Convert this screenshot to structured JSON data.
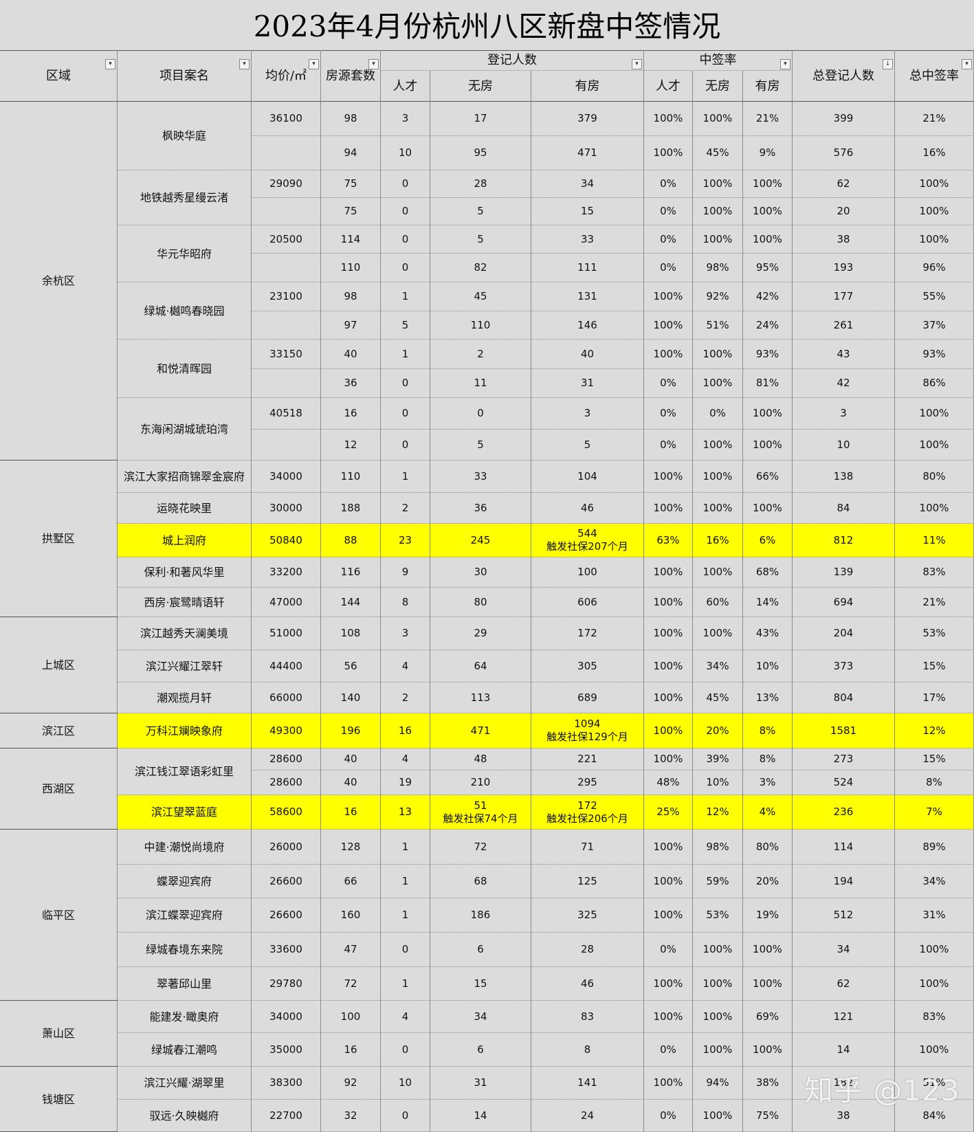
{
  "title": "2023年4月份杭州八区新盘中签情况",
  "headers": {
    "region": "区域",
    "project": "项目案名",
    "price": "均价/㎡",
    "units": "房源套数",
    "registered_group": "登记人数",
    "rate_group": "中签率",
    "talent": "人才",
    "no_house": "无房",
    "has_house": "有房",
    "total_registered": "总登记人数",
    "total_rate": "总中签率"
  },
  "rows": [
    {
      "region": "余杭区",
      "project": "枫映华庭",
      "price": "36100",
      "units": "98",
      "reg_talent": "3",
      "reg_nohouse": "17",
      "reg_hashouse": "379",
      "rate_talent": "100%",
      "rate_nohouse": "100%",
      "rate_hashouse": "21%",
      "total_reg": "399",
      "total_rate": "21%"
    },
    {
      "region": "",
      "project": "",
      "price": "",
      "units": "94",
      "reg_talent": "10",
      "reg_nohouse": "95",
      "reg_hashouse": "471",
      "rate_talent": "100%",
      "rate_nohouse": "45%",
      "rate_hashouse": "9%",
      "total_reg": "576",
      "total_rate": "16%"
    },
    {
      "region": "",
      "project": "地铁越秀星缦云渚",
      "price": "29090",
      "units": "75",
      "reg_talent": "0",
      "reg_nohouse": "28",
      "reg_hashouse": "34",
      "rate_talent": "0%",
      "rate_nohouse": "100%",
      "rate_hashouse": "100%",
      "total_reg": "62",
      "total_rate": "100%"
    },
    {
      "region": "",
      "project": "",
      "price": "",
      "units": "75",
      "reg_talent": "0",
      "reg_nohouse": "5",
      "reg_hashouse": "15",
      "rate_talent": "0%",
      "rate_nohouse": "100%",
      "rate_hashouse": "100%",
      "total_reg": "20",
      "total_rate": "100%"
    },
    {
      "region": "",
      "project": "华元华昭府",
      "price": "20500",
      "units": "114",
      "reg_talent": "0",
      "reg_nohouse": "5",
      "reg_hashouse": "33",
      "rate_talent": "0%",
      "rate_nohouse": "100%",
      "rate_hashouse": "100%",
      "total_reg": "38",
      "total_rate": "100%"
    },
    {
      "region": "",
      "project": "",
      "price": "",
      "units": "110",
      "reg_talent": "0",
      "reg_nohouse": "82",
      "reg_hashouse": "111",
      "rate_talent": "0%",
      "rate_nohouse": "98%",
      "rate_hashouse": "95%",
      "total_reg": "193",
      "total_rate": "96%"
    },
    {
      "region": "",
      "project": "绿城·樾鸣春晓园",
      "price": "23100",
      "units": "98",
      "reg_talent": "1",
      "reg_nohouse": "45",
      "reg_hashouse": "131",
      "rate_talent": "100%",
      "rate_nohouse": "92%",
      "rate_hashouse": "42%",
      "total_reg": "177",
      "total_rate": "55%"
    },
    {
      "region": "",
      "project": "",
      "price": "",
      "units": "97",
      "reg_talent": "5",
      "reg_nohouse": "110",
      "reg_hashouse": "146",
      "rate_talent": "100%",
      "rate_nohouse": "51%",
      "rate_hashouse": "24%",
      "total_reg": "261",
      "total_rate": "37%"
    },
    {
      "region": "",
      "project": "和悦清晖园",
      "price": "33150",
      "units": "40",
      "reg_talent": "1",
      "reg_nohouse": "2",
      "reg_hashouse": "40",
      "rate_talent": "100%",
      "rate_nohouse": "100%",
      "rate_hashouse": "93%",
      "total_reg": "43",
      "total_rate": "93%"
    },
    {
      "region": "",
      "project": "",
      "price": "",
      "units": "36",
      "reg_talent": "0",
      "reg_nohouse": "11",
      "reg_hashouse": "31",
      "rate_talent": "0%",
      "rate_nohouse": "100%",
      "rate_hashouse": "81%",
      "total_reg": "42",
      "total_rate": "86%"
    },
    {
      "region": "",
      "project": "东海闲湖城琥珀湾",
      "price": "40518",
      "units": "16",
      "reg_talent": "0",
      "reg_nohouse": "0",
      "reg_hashouse": "3",
      "rate_talent": "0%",
      "rate_nohouse": "0%",
      "rate_hashouse": "100%",
      "total_reg": "3",
      "total_rate": "100%"
    },
    {
      "region": "",
      "project": "",
      "price": "",
      "units": "12",
      "reg_talent": "0",
      "reg_nohouse": "5",
      "reg_hashouse": "5",
      "rate_talent": "0%",
      "rate_nohouse": "100%",
      "rate_hashouse": "100%",
      "total_reg": "10",
      "total_rate": "100%"
    },
    {
      "region": "拱墅区",
      "project": "滨江大家招商锦翠金宸府",
      "price": "34000",
      "units": "110",
      "reg_talent": "1",
      "reg_nohouse": "33",
      "reg_hashouse": "104",
      "rate_talent": "100%",
      "rate_nohouse": "100%",
      "rate_hashouse": "66%",
      "total_reg": "138",
      "total_rate": "80%"
    },
    {
      "region": "",
      "project": "运晓花映里",
      "price": "30000",
      "units": "188",
      "reg_talent": "2",
      "reg_nohouse": "36",
      "reg_hashouse": "46",
      "rate_talent": "100%",
      "rate_nohouse": "100%",
      "rate_hashouse": "100%",
      "total_reg": "84",
      "total_rate": "100%"
    },
    {
      "region": "",
      "project": "城上润府",
      "price": "50840",
      "units": "88",
      "reg_talent": "23",
      "reg_nohouse": "245",
      "reg_hashouse": "544\n触发社保207个月",
      "rate_talent": "63%",
      "rate_nohouse": "16%",
      "rate_hashouse": "6%",
      "total_reg": "812",
      "total_rate": "11%",
      "highlight": true
    },
    {
      "region": "",
      "project": "保利·和著风华里",
      "price": "33200",
      "units": "116",
      "reg_talent": "9",
      "reg_nohouse": "30",
      "reg_hashouse": "100",
      "rate_talent": "100%",
      "rate_nohouse": "100%",
      "rate_hashouse": "68%",
      "total_reg": "139",
      "total_rate": "83%"
    },
    {
      "region": "",
      "project": "西房·宸鹭晴语轩",
      "price": "47000",
      "units": "144",
      "reg_talent": "8",
      "reg_nohouse": "80",
      "reg_hashouse": "606",
      "rate_talent": "100%",
      "rate_nohouse": "60%",
      "rate_hashouse": "14%",
      "total_reg": "694",
      "total_rate": "21%"
    },
    {
      "region": "上城区",
      "project": "滨江越秀天澜美境",
      "price": "51000",
      "units": "108",
      "reg_talent": "3",
      "reg_nohouse": "29",
      "reg_hashouse": "172",
      "rate_talent": "100%",
      "rate_nohouse": "100%",
      "rate_hashouse": "43%",
      "total_reg": "204",
      "total_rate": "53%"
    },
    {
      "region": "",
      "project": "滨江兴耀江翠轩",
      "price": "44400",
      "units": "56",
      "reg_talent": "4",
      "reg_nohouse": "64",
      "reg_hashouse": "305",
      "rate_talent": "100%",
      "rate_nohouse": "34%",
      "rate_hashouse": "10%",
      "total_reg": "373",
      "total_rate": "15%"
    },
    {
      "region": "",
      "project": "潮观揽月轩",
      "price": "66000",
      "units": "140",
      "reg_talent": "2",
      "reg_nohouse": "113",
      "reg_hashouse": "689",
      "rate_talent": "100%",
      "rate_nohouse": "45%",
      "rate_hashouse": "13%",
      "total_reg": "804",
      "total_rate": "17%"
    },
    {
      "region": "滨江区",
      "project": "万科江斓映象府",
      "price": "49300",
      "units": "196",
      "reg_talent": "16",
      "reg_nohouse": "471",
      "reg_hashouse": "1094\n触发社保129个月",
      "rate_talent": "100%",
      "rate_nohouse": "20%",
      "rate_hashouse": "8%",
      "total_reg": "1581",
      "total_rate": "12%",
      "highlight": true
    },
    {
      "region": "西湖区",
      "project": "滨江钱江翠语彩虹里",
      "price": "28600",
      "units": "40",
      "reg_talent": "4",
      "reg_nohouse": "48",
      "reg_hashouse": "221",
      "rate_talent": "100%",
      "rate_nohouse": "39%",
      "rate_hashouse": "8%",
      "total_reg": "273",
      "total_rate": "15%"
    },
    {
      "region": "",
      "project": "",
      "price": "28600",
      "units": "40",
      "reg_talent": "19",
      "reg_nohouse": "210",
      "reg_hashouse": "295",
      "rate_talent": "48%",
      "rate_nohouse": "10%",
      "rate_hashouse": "3%",
      "total_reg": "524",
      "total_rate": "8%"
    },
    {
      "region": "",
      "project": "滨江望翠蓝庭",
      "price": "58600",
      "units": "16",
      "reg_talent": "13",
      "reg_nohouse": "51\n触发社保74个月",
      "reg_hashouse": "172\n触发社保206个月",
      "rate_talent": "25%",
      "rate_nohouse": "12%",
      "rate_hashouse": "4%",
      "total_reg": "236",
      "total_rate": "7%",
      "highlight": true
    },
    {
      "region": "临平区",
      "project": "中建·潮悦尚境府",
      "price": "26000",
      "units": "128",
      "reg_talent": "1",
      "reg_nohouse": "72",
      "reg_hashouse": "71",
      "rate_talent": "100%",
      "rate_nohouse": "98%",
      "rate_hashouse": "80%",
      "total_reg": "114",
      "total_rate": "89%"
    },
    {
      "region": "",
      "project": "蝶翠迎宾府",
      "price": "26600",
      "units": "66",
      "reg_talent": "1",
      "reg_nohouse": "68",
      "reg_hashouse": "125",
      "rate_talent": "100%",
      "rate_nohouse": "59%",
      "rate_hashouse": "20%",
      "total_reg": "194",
      "total_rate": "34%"
    },
    {
      "region": "",
      "project": "滨江蝶翠迎宾府",
      "price": "26600",
      "units": "160",
      "reg_talent": "1",
      "reg_nohouse": "186",
      "reg_hashouse": "325",
      "rate_talent": "100%",
      "rate_nohouse": "53%",
      "rate_hashouse": "19%",
      "total_reg": "512",
      "total_rate": "31%"
    },
    {
      "region": "",
      "project": "绿城春境东来院",
      "price": "33600",
      "units": "47",
      "reg_talent": "0",
      "reg_nohouse": "6",
      "reg_hashouse": "28",
      "rate_talent": "0%",
      "rate_nohouse": "100%",
      "rate_hashouse": "100%",
      "total_reg": "34",
      "total_rate": "100%"
    },
    {
      "region": "",
      "project": "翠著邱山里",
      "price": "29780",
      "units": "72",
      "reg_talent": "1",
      "reg_nohouse": "15",
      "reg_hashouse": "46",
      "rate_talent": "100%",
      "rate_nohouse": "100%",
      "rate_hashouse": "100%",
      "total_reg": "62",
      "total_rate": "100%"
    },
    {
      "region": "萧山区",
      "project": "能建发·瞰奥府",
      "price": "34000",
      "units": "100",
      "reg_talent": "4",
      "reg_nohouse": "34",
      "reg_hashouse": "83",
      "rate_talent": "100%",
      "rate_nohouse": "100%",
      "rate_hashouse": "69%",
      "total_reg": "121",
      "total_rate": "83%"
    },
    {
      "region": "",
      "project": "绿城春江潮鸣",
      "price": "35000",
      "units": "16",
      "reg_talent": "0",
      "reg_nohouse": "6",
      "reg_hashouse": "8",
      "rate_talent": "0%",
      "rate_nohouse": "100%",
      "rate_hashouse": "100%",
      "total_reg": "14",
      "total_rate": "100%"
    },
    {
      "region": "钱塘区",
      "project": "滨江兴耀·湖翠里",
      "price": "38300",
      "units": "92",
      "reg_talent": "10",
      "reg_nohouse": "31",
      "reg_hashouse": "141",
      "rate_talent": "100%",
      "rate_nohouse": "94%",
      "rate_hashouse": "38%",
      "total_reg": "182",
      "total_rate": "51%"
    },
    {
      "region": "",
      "project": "驭远·久映樾府",
      "price": "22700",
      "units": "32",
      "reg_talent": "0",
      "reg_nohouse": "14",
      "reg_hashouse": "24",
      "rate_talent": "0%",
      "rate_nohouse": "100%",
      "rate_hashouse": "75%",
      "total_reg": "38",
      "total_rate": "84%"
    }
  ],
  "watermark": "知乎 @123"
}
